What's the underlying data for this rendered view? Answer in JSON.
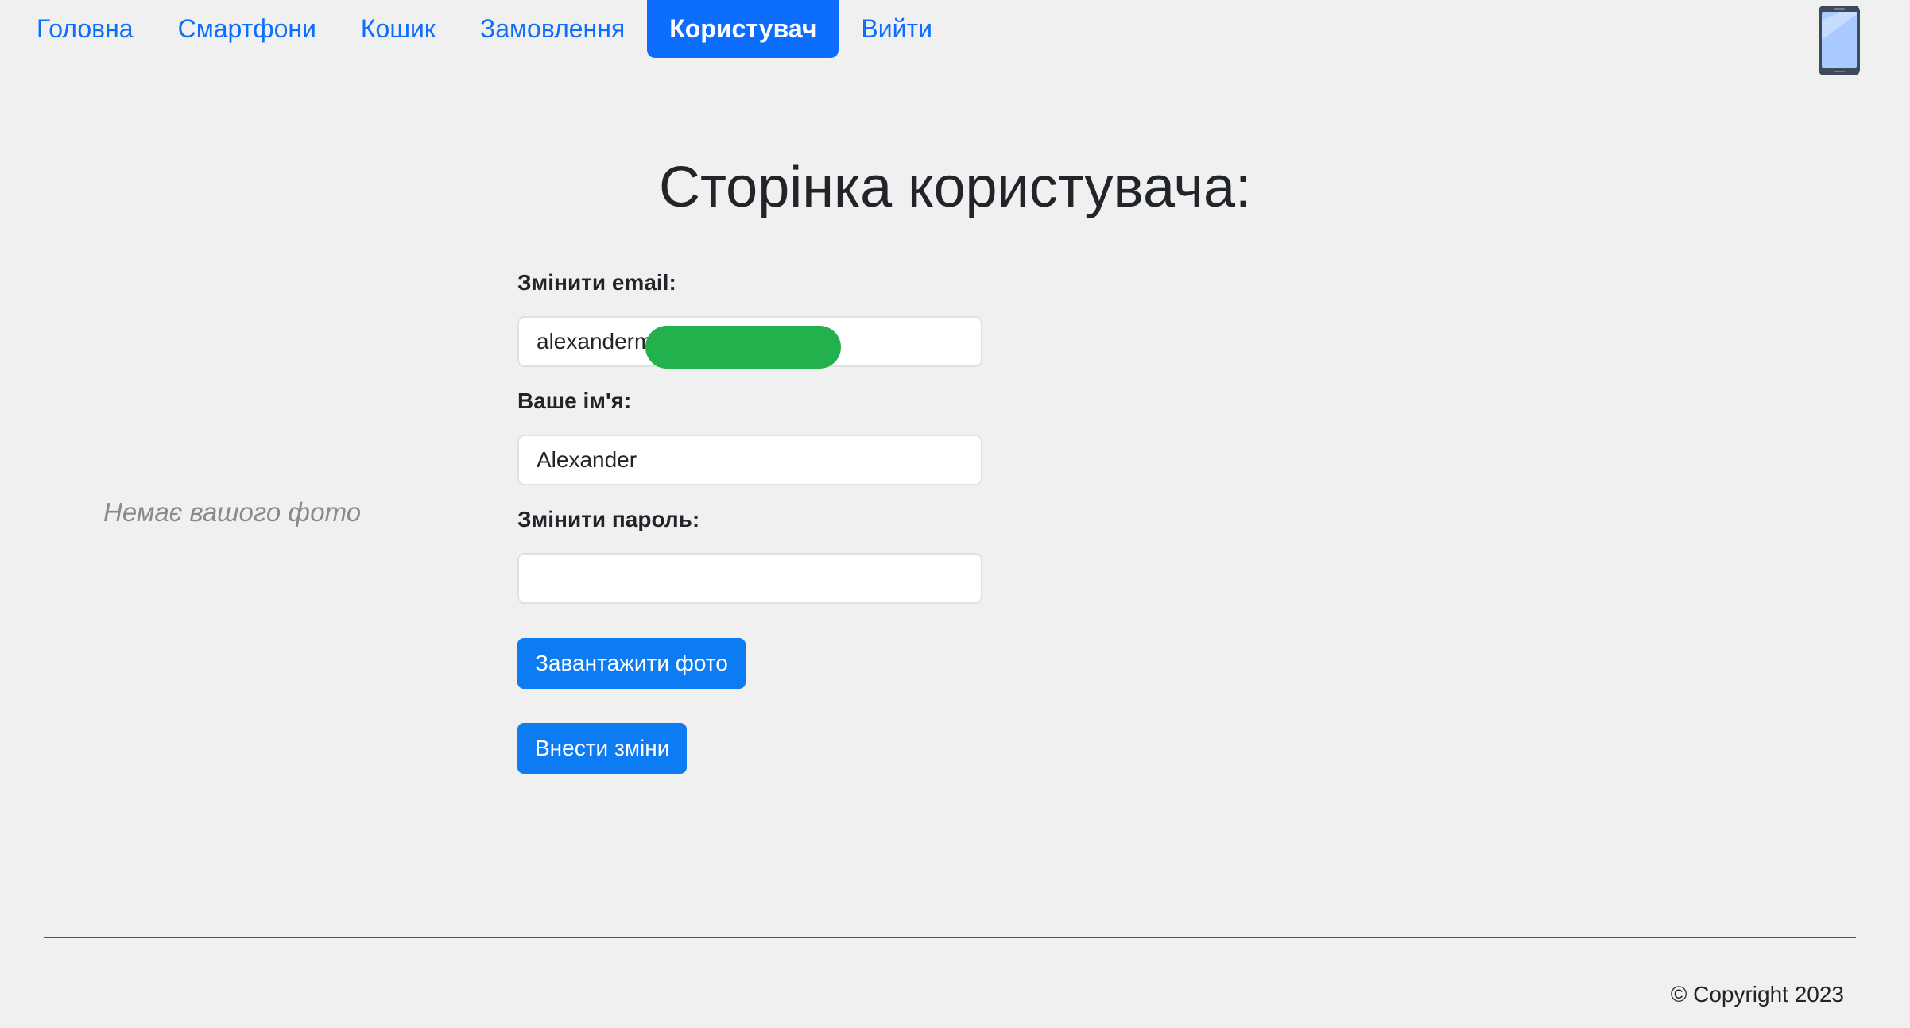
{
  "nav": {
    "items": [
      {
        "label": "Головна",
        "active": false
      },
      {
        "label": "Смартфони",
        "active": false
      },
      {
        "label": "Кошик",
        "active": false
      },
      {
        "label": "Замовлення",
        "active": false
      },
      {
        "label": "Користувач",
        "active": true
      },
      {
        "label": "Вийти",
        "active": false
      }
    ],
    "logo_icon": "smartphone-icon"
  },
  "page": {
    "title": "Сторінка користувача:",
    "no_photo_text": "Немає вашого фото"
  },
  "form": {
    "email_label": "Змінити email:",
    "email_value": "alexanderm",
    "name_label": "Ваше ім'я:",
    "name_value": "Alexander",
    "password_label": "Змінити пароль:",
    "password_value": "",
    "upload_button": "Завантажити фото",
    "submit_button": "Внести зміни"
  },
  "footer": {
    "copyright": "© Copyright 2023"
  },
  "colors": {
    "accent": "#0d6efd",
    "background": "#f0f0f0",
    "redaction": "#22b14c"
  }
}
